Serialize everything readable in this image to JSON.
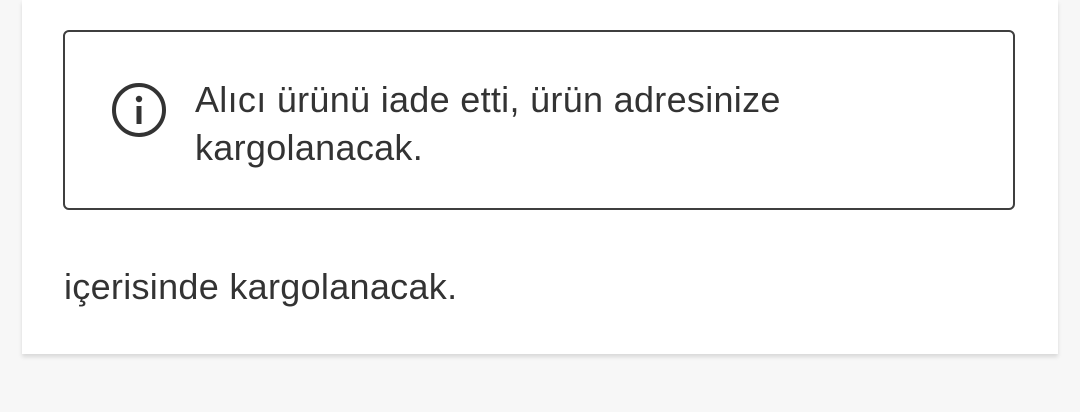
{
  "notice": {
    "icon": "info-icon",
    "message": "Alıcı ürünü iade etti, ürün adresinize kargolanacak."
  },
  "body": {
    "text": "içerisinde kargolanacak."
  },
  "colors": {
    "text": "#333333",
    "border": "#3f3f3f",
    "card_bg": "#ffffff",
    "page_bg": "#f7f7f7"
  }
}
